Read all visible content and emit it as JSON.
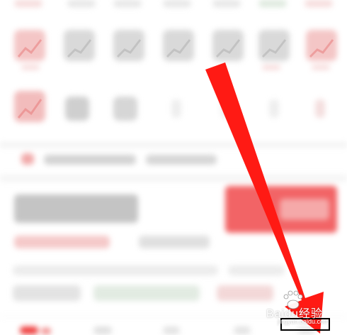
{
  "colors": {
    "accent_red": "#f03a3f",
    "arrow_red": "#ff1a14",
    "highlight_box": "#000000"
  },
  "icons": [
    "paw-icon",
    "chart-up-icon",
    "home-tab-icon",
    "search-tab-icon",
    "settings-tab-icon",
    "alert-tab-icon",
    "profile-tab-icon"
  ],
  "watermark": {
    "brand": "Baidu",
    "suffix": "经验",
    "url": "jingyan.baidu.com"
  }
}
